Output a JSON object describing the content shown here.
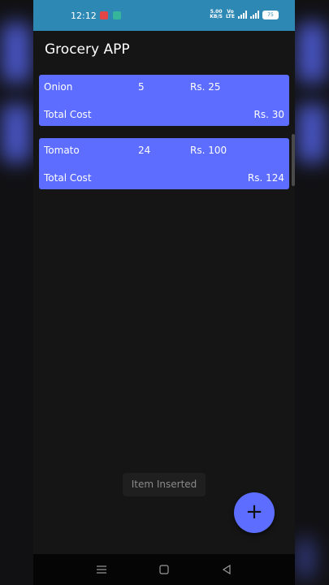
{
  "status_bar": {
    "time": "12:12",
    "network_speed_value": "5.00",
    "network_speed_unit": "KB/S",
    "volte_top": "Vo",
    "volte_bottom": "LTE",
    "battery": "75"
  },
  "app_bar": {
    "title": "Grocery APP"
  },
  "items": [
    {
      "name": "Onion",
      "quantity": "5",
      "price": "Rs. 25",
      "total_label": "Total Cost",
      "total_value": "Rs. 30"
    },
    {
      "name": "Tomato",
      "quantity": "24",
      "price": "Rs. 100",
      "total_label": "Total Cost",
      "total_value": "Rs. 124"
    }
  ],
  "toast": {
    "message": "Item Inserted"
  },
  "fab": {
    "icon": "plus-icon",
    "glyph": "+"
  },
  "colors": {
    "status_bar": "#2d88b4",
    "card": "#5c6dff",
    "fab": "#5c6dff",
    "background": "#151515"
  }
}
